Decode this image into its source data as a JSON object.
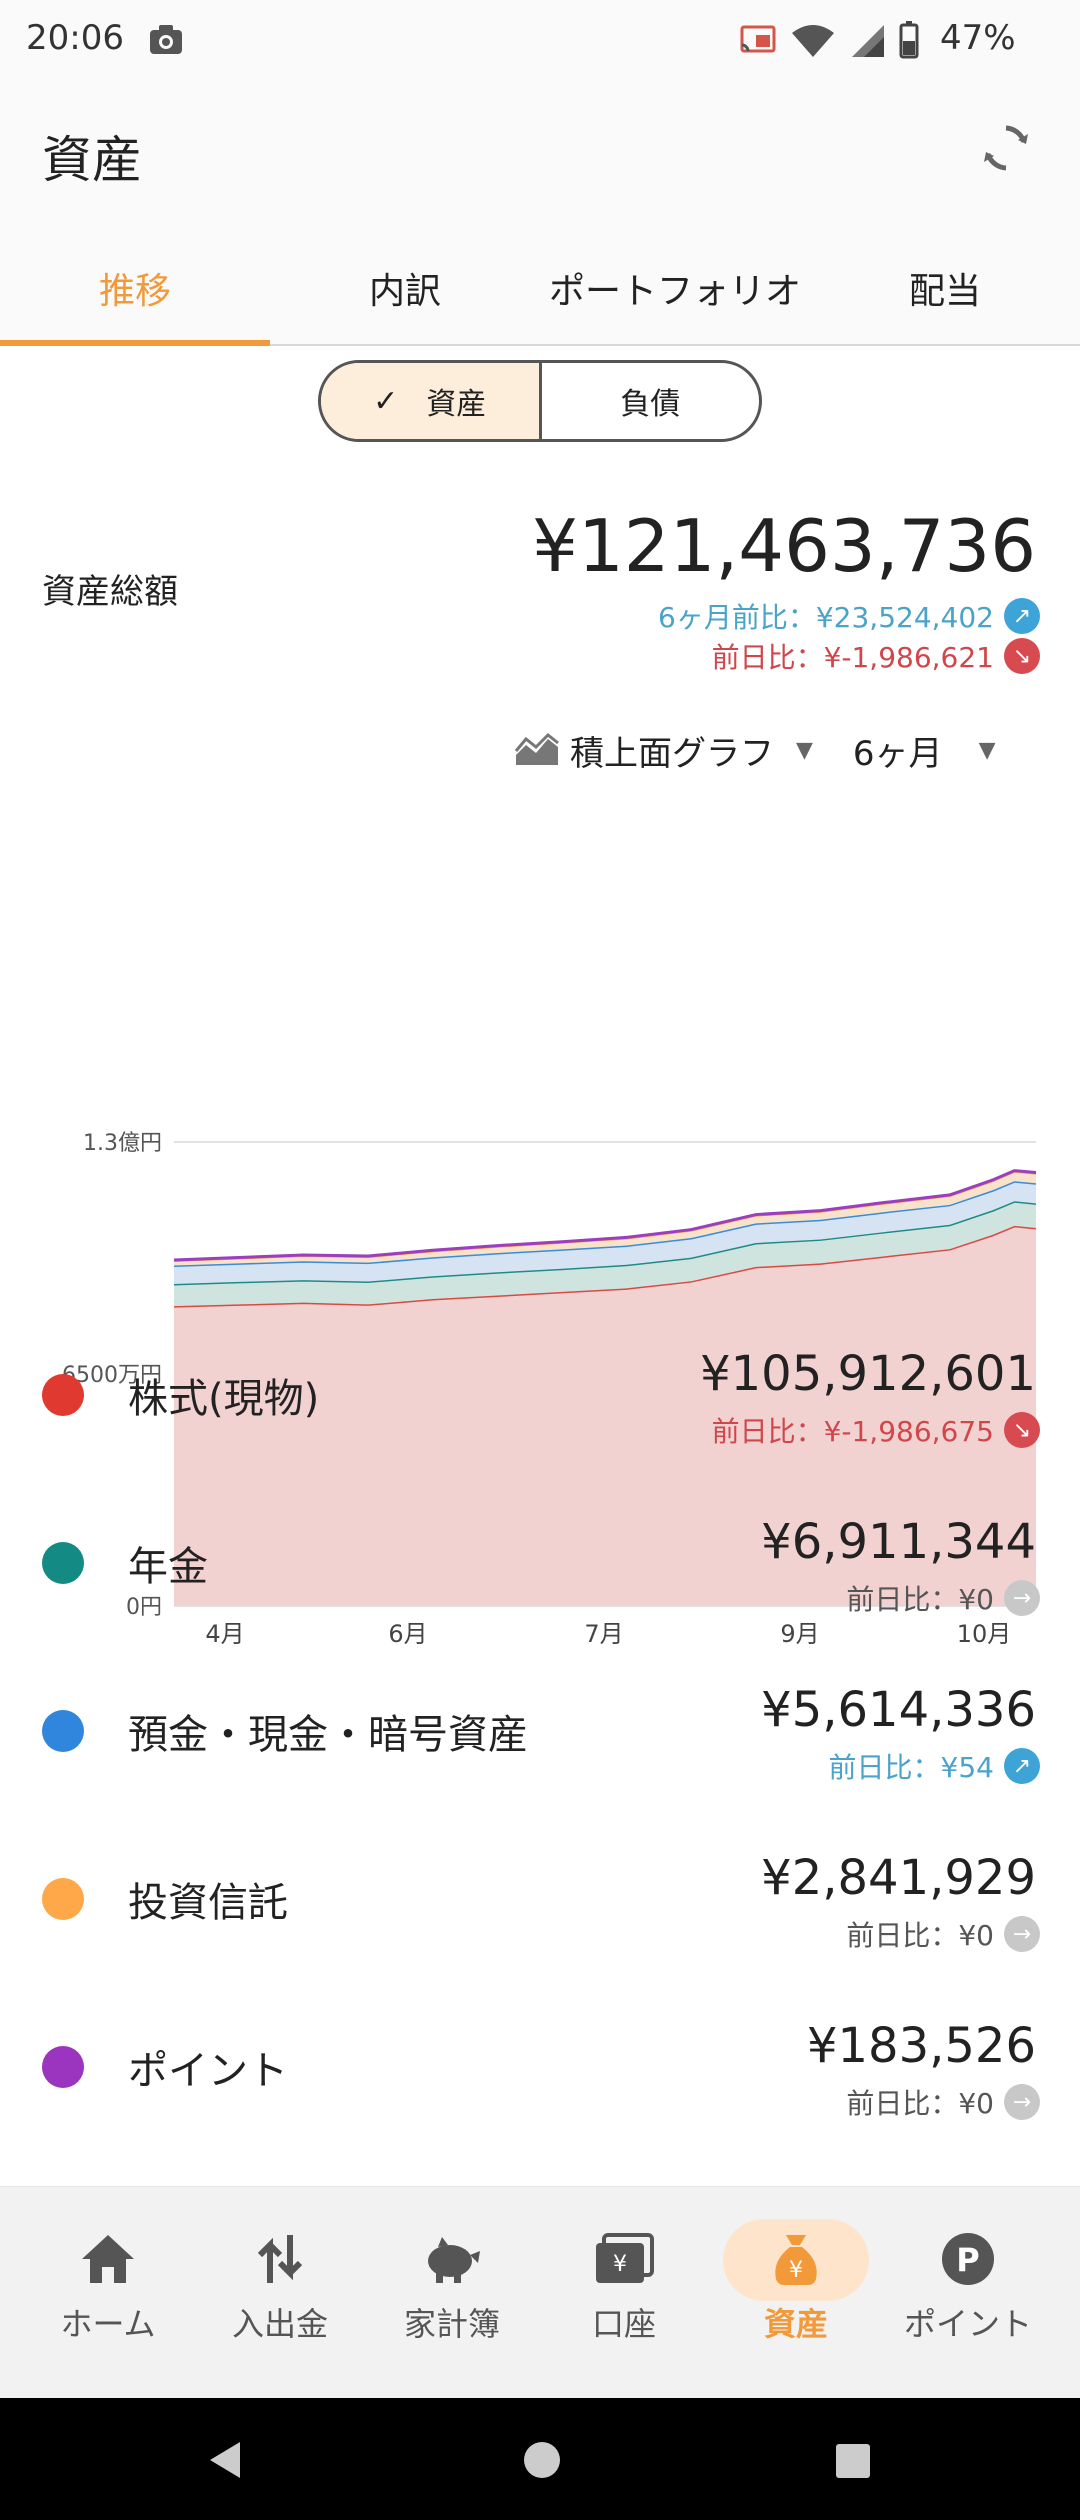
{
  "status_bar": {
    "time": "20:06",
    "battery": "47%"
  },
  "app_bar": {
    "title": "資産"
  },
  "tabs": [
    {
      "label": "推移",
      "active": true
    },
    {
      "label": "内訳",
      "active": false
    },
    {
      "label": "ポートフォリオ",
      "active": false
    },
    {
      "label": "配当",
      "active": false
    }
  ],
  "toggle": {
    "asset_label": "資産",
    "liability_label": "負債",
    "selected": "資産"
  },
  "summary": {
    "total_label": "資産総額",
    "total_value": "¥121,463,736",
    "six_month_change": "6ヶ月前比：¥23,524,402",
    "day_change": "前日比：¥-1,986,621"
  },
  "chart_controls": {
    "chart_type": "積上面グラフ",
    "period": "6ヶ月"
  },
  "chart_data": {
    "type": "area",
    "stacked": true,
    "title": "",
    "x_ticks": [
      "4月",
      "6月",
      "7月",
      "9月",
      "10月"
    ],
    "y_ticks": [
      "1.3億円",
      "6500万円",
      "0円"
    ],
    "ylim": [
      0,
      130000000
    ],
    "grid": true,
    "x": [
      0,
      15,
      30,
      45,
      60,
      75,
      90,
      105,
      120,
      135,
      150,
      165,
      180,
      190,
      195,
      200
    ],
    "series": [
      {
        "name": "株式(現物)",
        "color": "#d94a42",
        "values": [
          84000000,
          84500000,
          85000000,
          84500000,
          86000000,
          87000000,
          88000000,
          89000000,
          91000000,
          95000000,
          96000000,
          98000000,
          100000000,
          104000000,
          106500000,
          105900000
        ]
      },
      {
        "name": "年金",
        "color": "#1e8c86",
        "values": [
          6200000,
          6300000,
          6300000,
          6400000,
          6400000,
          6500000,
          6500000,
          6600000,
          6600000,
          6700000,
          6700000,
          6800000,
          6800000,
          6900000,
          6900000,
          6911344
        ]
      },
      {
        "name": "預金・現金・暗号資産",
        "color": "#3a8bd8",
        "values": [
          5200000,
          5200000,
          5300000,
          5300000,
          5300000,
          5400000,
          5400000,
          5400000,
          5500000,
          5500000,
          5500000,
          5600000,
          5600000,
          5600000,
          5600000,
          5614336
        ]
      },
      {
        "name": "投資信託",
        "color": "#f6a24a",
        "values": [
          1400000,
          1500000,
          1600000,
          1700000,
          1800000,
          1900000,
          2000000,
          2100000,
          2200000,
          2300000,
          2400000,
          2500000,
          2600000,
          2700000,
          2800000,
          2841929
        ]
      },
      {
        "name": "ポイント",
        "color": "#9b3fc0",
        "values": [
          150000,
          150000,
          155000,
          155000,
          160000,
          160000,
          165000,
          165000,
          170000,
          170000,
          175000,
          175000,
          180000,
          180000,
          183000,
          183526
        ]
      }
    ]
  },
  "assets": [
    {
      "name": "株式(現物)",
      "color": "#e03a30",
      "amount": "¥105,912,601",
      "change": "前日比：¥-1,986,675",
      "trend": "down"
    },
    {
      "name": "年金",
      "color": "#138a84",
      "amount": "¥6,911,344",
      "change": "前日比：¥0",
      "trend": "flat"
    },
    {
      "name": "預金・現金・暗号資産",
      "color": "#2f86dc",
      "amount": "¥5,614,336",
      "change": "前日比：¥54",
      "trend": "up"
    },
    {
      "name": "投資信託",
      "color": "#ffa84a",
      "amount": "¥2,841,929",
      "change": "前日比：¥0",
      "trend": "flat"
    },
    {
      "name": "ポイント",
      "color": "#9b34bf",
      "amount": "¥183,526",
      "change": "前日比：¥0",
      "trend": "flat"
    }
  ],
  "bottom_nav": [
    {
      "label": "ホーム",
      "icon": "home-icon",
      "active": false
    },
    {
      "label": "入出金",
      "icon": "transfer-icon",
      "active": false
    },
    {
      "label": "家計簿",
      "icon": "piggy-bank-icon",
      "active": false
    },
    {
      "label": "口座",
      "icon": "account-icon",
      "active": false
    },
    {
      "label": "資産",
      "icon": "asset-bag-icon",
      "active": true
    },
    {
      "label": "ポイント",
      "icon": "point-icon",
      "active": false
    }
  ],
  "colors": {
    "accent": "#f29a3a",
    "positive": "#4aa3c8",
    "negative": "#d0474b"
  }
}
